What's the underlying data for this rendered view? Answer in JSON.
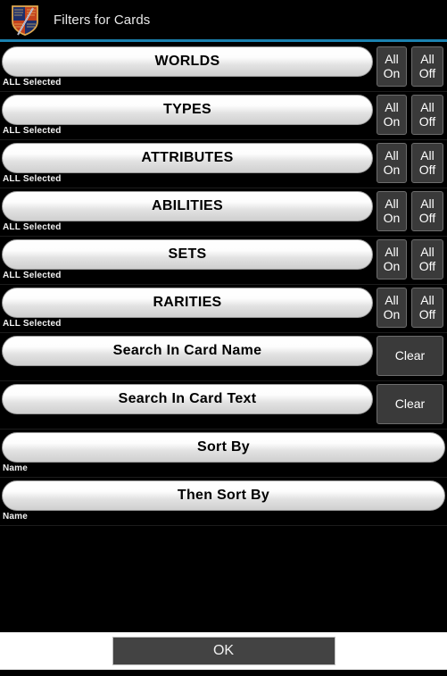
{
  "titlebar": {
    "app_icon_name": "shield-crest-icon",
    "title": "Filters for Cards",
    "accent_color": "#1b82b0"
  },
  "filters": [
    {
      "label": "WORLDS",
      "caption": "ALL Selected",
      "all_on": "All On",
      "all_off": "All Off"
    },
    {
      "label": "TYPES",
      "caption": "ALL Selected",
      "all_on": "All On",
      "all_off": "All Off"
    },
    {
      "label": "ATTRIBUTES",
      "caption": "ALL Selected",
      "all_on": "All On",
      "all_off": "All Off"
    },
    {
      "label": "ABILITIES",
      "caption": "ALL Selected",
      "all_on": "All On",
      "all_off": "All Off"
    },
    {
      "label": "SETS",
      "caption": "ALL Selected",
      "all_on": "All On",
      "all_off": "All Off"
    },
    {
      "label": "RARITIES",
      "caption": "ALL Selected",
      "all_on": "All On",
      "all_off": "All Off"
    }
  ],
  "searches": [
    {
      "label": "Search In Card Name",
      "value": "",
      "clear": "Clear"
    },
    {
      "label": "Search In Card Text",
      "value": "",
      "clear": "Clear"
    }
  ],
  "sorts": [
    {
      "label": "Sort By",
      "value": "Name"
    },
    {
      "label": "Then Sort By",
      "value": "Name"
    }
  ],
  "bottom": {
    "ok_label": "OK"
  },
  "all_on_line1": "All",
  "all_on_line2": "On",
  "all_off_line1": "All",
  "all_off_line2": "Off"
}
